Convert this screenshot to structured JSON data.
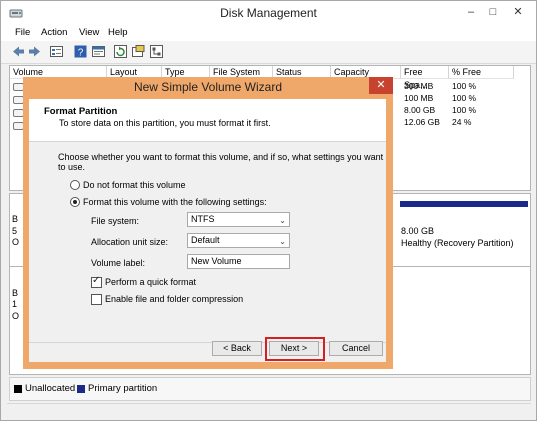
{
  "window": {
    "title": "Disk Management",
    "minimize": "–",
    "maximize": "□",
    "close": "✕"
  },
  "menu": [
    "File",
    "Action",
    "View",
    "Help"
  ],
  "toolbar": [
    "back-arrow-icon",
    "forward-arrow-icon",
    "list-view-icon",
    "help-icon",
    "properties-icon",
    "refresh-icon",
    "console-icon",
    "tree-icon"
  ],
  "volume_list": {
    "columns": [
      "Volume",
      "Layout",
      "Type",
      "File System",
      "Status",
      "Capacity",
      "Free Spa...",
      "% Free"
    ],
    "rows": [
      {
        "free": "300 MB",
        "pct": "100 %"
      },
      {
        "free": "100 MB",
        "pct": "100 %"
      },
      {
        "free": "8.00 GB",
        "pct": "100 %"
      },
      {
        "free": "12.06 GB",
        "pct": "24 %"
      }
    ]
  },
  "disk_area": {
    "partition_size": "8.00 GB",
    "partition_status": "Healthy (Recovery Partition)",
    "left_letters_1": [
      "B",
      "5",
      "O"
    ],
    "left_letters_2": [
      "B",
      "1",
      "O"
    ]
  },
  "legend": {
    "unallocated": "Unallocated",
    "primary": "Primary partition",
    "unallocated_color": "#000000",
    "primary_color": "#1a2a8a"
  },
  "dialog": {
    "title": "New Simple Volume Wizard",
    "close": "✕",
    "header_title": "Format Partition",
    "header_subtitle": "To store data on this partition, you must format it first.",
    "intro": "Choose whether you want to format this volume, and if so, what settings you want to use.",
    "radio_no_format": "Do not format this volume",
    "radio_format": "Format this volume with the following settings:",
    "file_system_label": "File system:",
    "file_system_value": "NTFS",
    "allocation_label": "Allocation unit size:",
    "allocation_value": "Default",
    "volume_label_label": "Volume label:",
    "volume_label_value": "New Volume",
    "quick_format": "Perform a quick format",
    "compression": "Enable file and folder compression",
    "back_button": "< Back",
    "next_button": "Next >",
    "cancel_button": "Cancel"
  }
}
